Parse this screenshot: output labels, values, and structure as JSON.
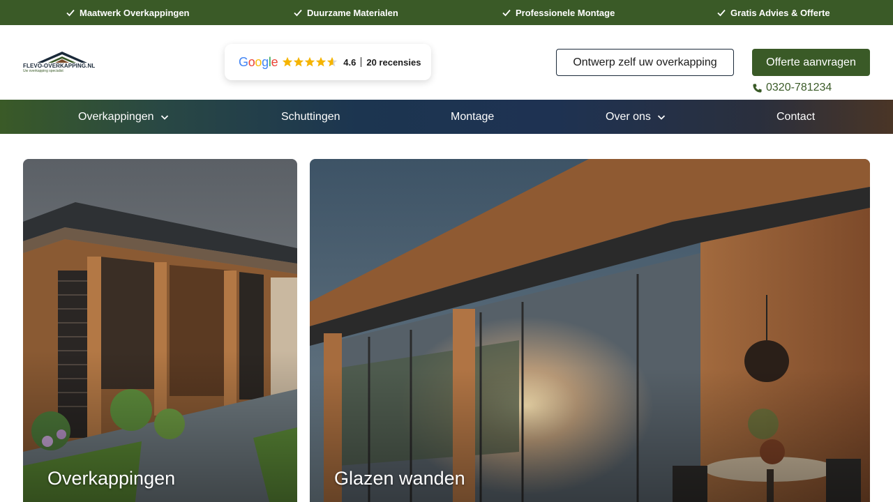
{
  "usp_bar": {
    "items": [
      {
        "label": "Maatwerk Overkappingen",
        "icon": "check-icon"
      },
      {
        "label": "Duurzame Materialen",
        "icon": "check-icon"
      },
      {
        "label": "Professionele Montage",
        "icon": "check-icon"
      },
      {
        "label": "Gratis Advies & Offerte",
        "icon": "check-icon"
      }
    ]
  },
  "header": {
    "logo": {
      "name": "FLEVO-OVERKAPPING.NL",
      "tagline": "Uw overkapping specialist"
    },
    "review": {
      "brand": "Google",
      "rating": "4.6",
      "stars": 4.6,
      "count": "20 recensies"
    },
    "design_button": "Ontwerp zelf uw overkapping",
    "quote_button": "Offerte aanvragen",
    "phone": "0320-781234"
  },
  "nav": {
    "items": [
      {
        "label": "Overkappingen",
        "dropdown": true
      },
      {
        "label": "Schuttingen",
        "dropdown": false
      },
      {
        "label": "Montage",
        "dropdown": false
      },
      {
        "label": "Over ons",
        "dropdown": true
      },
      {
        "label": "Contact",
        "dropdown": false
      }
    ]
  },
  "cards": [
    {
      "title": "Overkappingen"
    },
    {
      "title": "Glazen wanden"
    }
  ],
  "colors": {
    "brand_green": "#3a5a27",
    "nav_blue": "#1c3550",
    "text_dark": "#1b1b1b",
    "star_gold": "#f5b400"
  }
}
